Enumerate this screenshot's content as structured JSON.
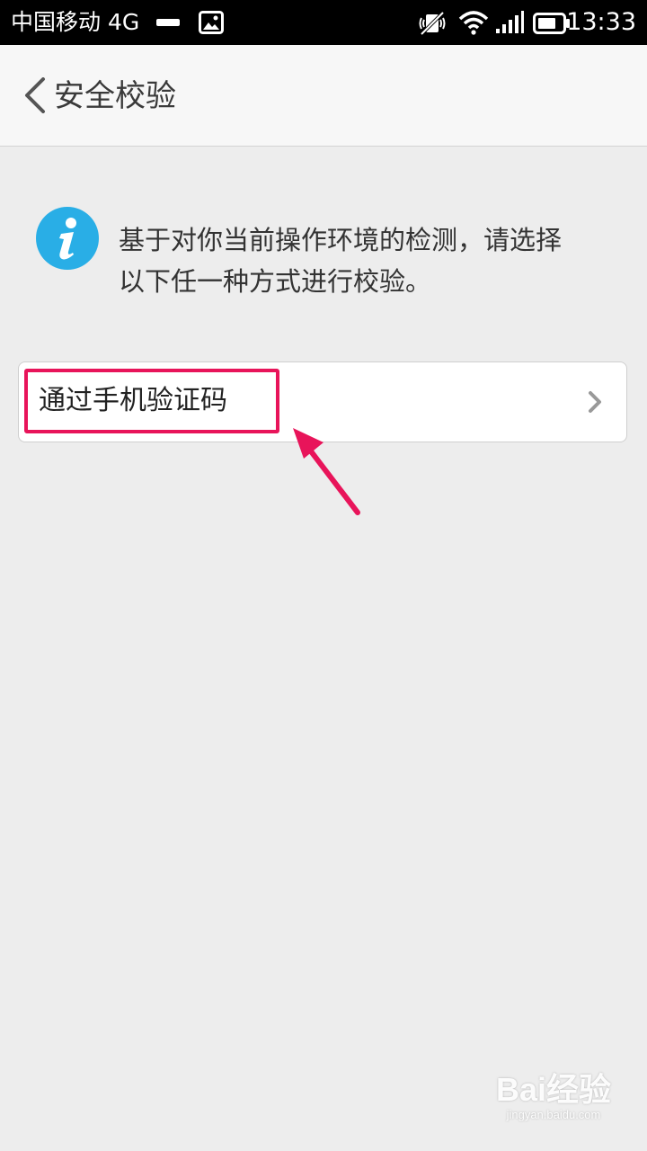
{
  "status_bar": {
    "carrier": "中国移动 4G",
    "time": "13:33",
    "icons": [
      "minus-indicator",
      "image-notification-icon",
      "mute-icon",
      "wifi-icon",
      "signal-icon",
      "battery-icon"
    ]
  },
  "header": {
    "back_icon": "chevron-left-icon",
    "title": "安全校验"
  },
  "notice": {
    "icon": "info-icon",
    "line1": "基于对你当前操作环境的检测，请选择",
    "line2": "以下任一种方式进行校验。"
  },
  "options": [
    {
      "label": "通过手机验证码",
      "icon": "chevron-right-icon"
    }
  ],
  "colors": {
    "background": "#ededed",
    "info_blue": "#29aee6",
    "highlight": "#e8145a"
  },
  "watermark": {
    "logo": "Bai经验",
    "url": "jingyan.baidu.com"
  }
}
